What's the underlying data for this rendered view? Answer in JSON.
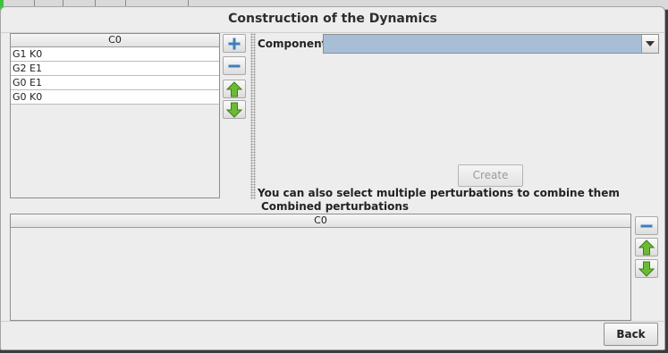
{
  "window": {
    "title": "Construction of the Dynamics"
  },
  "perturbations": {
    "column_header": "C0",
    "rows": [
      "G1 K0",
      "G2 E1",
      "G0 E1",
      "G0 K0"
    ]
  },
  "side_buttons": {
    "add_icon": "plus-icon",
    "remove_icon": "minus-icon",
    "up_icon": "green-arrow-up-icon",
    "down_icon": "green-arrow-down-icon"
  },
  "component": {
    "label": "Component",
    "selected": ""
  },
  "create_button": {
    "label": "Create",
    "enabled": false
  },
  "hint": "You can also select multiple perturbations to combine them",
  "combined": {
    "title": "Combined perturbations",
    "column_header": "C0",
    "rows": []
  },
  "back_button": {
    "label": "Back"
  },
  "colors": {
    "combo_selected_bg": "#a7bed6",
    "icon_blue": "#3d7fc1",
    "arrow_green": "#5aa82b"
  }
}
